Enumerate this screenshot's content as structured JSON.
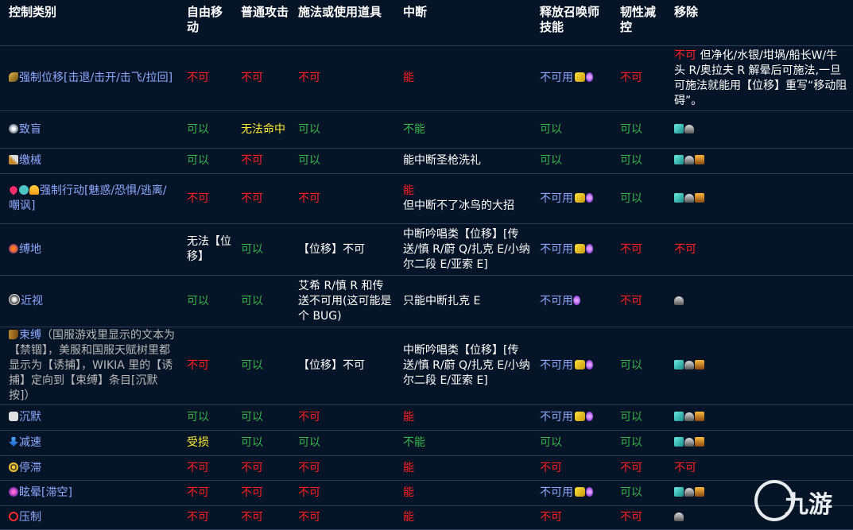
{
  "headers": [
    "控制类别",
    "自由移动",
    "普通攻击",
    "施法或使用道具",
    "中断",
    "释放召唤师技能",
    "韧性减控",
    "移除"
  ],
  "rows": [
    {
      "icons": [
        "knock-icon"
      ],
      "name": "强制位移[击退/击开/击飞/拉回]",
      "note": "",
      "move": {
        "text": "不可",
        "color": "red"
      },
      "attack": {
        "text": "不可",
        "color": "red"
      },
      "cast": {
        "text": "不可",
        "color": "red"
      },
      "interrupt": {
        "lines": [
          {
            "text": "能",
            "color": "red"
          }
        ]
      },
      "summoner": {
        "text": "不可用",
        "color": "blue",
        "icons": [
          "flash-icon",
          "purple-icon"
        ]
      },
      "tenacity": {
        "text": "不可",
        "color": "red"
      },
      "remove": {
        "prefix": "不可",
        "prefix_color": "red",
        "text": " 但净化/水银/坩埚/船长W/牛头 R/奥拉夫 R 解晕后可施法,一旦可施法就能用【位移】重写“移动阻碍”。",
        "icons": []
      }
    },
    {
      "icons": [
        "blind-icon"
      ],
      "name": "致盲",
      "note": "",
      "move": {
        "text": "可以",
        "color": "green"
      },
      "attack": {
        "text": "无法命中",
        "color": "yellow"
      },
      "cast": {
        "text": "可以",
        "color": "green"
      },
      "interrupt": {
        "lines": [
          {
            "text": "不能",
            "color": "green"
          }
        ]
      },
      "summoner": {
        "text": "可以",
        "color": "green",
        "icons": []
      },
      "tenacity": {
        "text": "可以",
        "color": "green"
      },
      "remove": {
        "prefix": "",
        "prefix_color": "",
        "text": "",
        "icons": [
          "cleanse-icon",
          "qss-icon"
        ]
      }
    },
    {
      "icons": [
        "disarm-icon"
      ],
      "name": "缴械",
      "note": "",
      "move": {
        "text": "可以",
        "color": "green"
      },
      "attack": {
        "text": "不可",
        "color": "red"
      },
      "cast": {
        "text": "可以",
        "color": "green"
      },
      "interrupt": {
        "lines": [
          {
            "text": "能中断圣枪洗礼",
            "color": "white"
          }
        ]
      },
      "summoner": {
        "text": "可以",
        "color": "green",
        "icons": []
      },
      "tenacity": {
        "text": "可以",
        "color": "green"
      },
      "remove": {
        "prefix": "",
        "prefix_color": "",
        "text": "",
        "icons": [
          "cleanse-icon",
          "qss-icon",
          "mercurial-icon"
        ]
      }
    },
    {
      "icons": [
        "charm-icon",
        "fear-icon",
        "flee-icon"
      ],
      "name": "强制行动[魅惑/恐惧/逃离/嘲讽]",
      "note": "",
      "move": {
        "text": "不可",
        "color": "red"
      },
      "attack": {
        "text": "不可",
        "color": "red"
      },
      "cast": {
        "text": "不可",
        "color": "red"
      },
      "interrupt": {
        "lines": [
          {
            "text": "能",
            "color": "red"
          },
          {
            "text": "但中断不了冰鸟的大招",
            "color": "white"
          }
        ]
      },
      "summoner": {
        "text": "不可用",
        "color": "blue",
        "icons": [
          "flash-icon",
          "purple-icon"
        ]
      },
      "tenacity": {
        "text": "可以",
        "color": "green"
      },
      "remove": {
        "prefix": "",
        "prefix_color": "",
        "text": "",
        "icons": [
          "cleanse-icon",
          "qss-icon",
          "mercurial-icon"
        ]
      }
    },
    {
      "icons": [
        "root-icon"
      ],
      "name": "缚地",
      "note": "",
      "move": {
        "text": "无法【位移】",
        "color": "white"
      },
      "attack": {
        "text": "可以",
        "color": "green"
      },
      "cast": {
        "text": "【位移】不可",
        "color": "white"
      },
      "interrupt": {
        "lines": [
          {
            "text": "中断吟唱类【位移】[传送/慎 R/蔚 Q/扎克 E/小纳尔二段 E/亚索 E]",
            "color": "white"
          }
        ]
      },
      "summoner": {
        "text": "不可用",
        "color": "blue",
        "icons": [
          "flash-icon",
          "purple-icon"
        ]
      },
      "tenacity": {
        "text": "不可",
        "color": "red"
      },
      "remove": {
        "prefix": "不可",
        "prefix_color": "red",
        "text": "",
        "icons": []
      }
    },
    {
      "icons": [
        "nearsight-icon"
      ],
      "name": "近视",
      "note": "",
      "move": {
        "text": "可以",
        "color": "green"
      },
      "attack": {
        "text": "可以",
        "color": "green"
      },
      "cast": {
        "text": "艾希 R/慎 R 和传送不可用(这可能是个 BUG)",
        "color": "white"
      },
      "interrupt": {
        "lines": [
          {
            "text": "只能中断扎克 E",
            "color": "white"
          }
        ]
      },
      "summoner": {
        "text": "不可用",
        "color": "blue",
        "icons": [
          "purple-icon"
        ]
      },
      "tenacity": {
        "text": "不可",
        "color": "red"
      },
      "remove": {
        "prefix": "",
        "prefix_color": "",
        "text": "",
        "icons": [
          "qss-icon"
        ]
      }
    },
    {
      "icons": [
        "boot-icon"
      ],
      "name": "束缚",
      "note": "（国服游戏里显示的文本为【禁锢】，美服和国服天赋树里都显示为【诱捕】，WIKIA 里的【诱捕】定向到【束缚】条目[沉默按]）",
      "move": {
        "text": "不可",
        "color": "red"
      },
      "attack": {
        "text": "可以",
        "color": "green"
      },
      "cast": {
        "text": "【位移】不可",
        "color": "white"
      },
      "interrupt": {
        "lines": [
          {
            "text": "中断吟唱类【位移】[传送/慎 R/蔚 Q/扎克 E/小纳尔二段 E/亚索 E]",
            "color": "white"
          }
        ]
      },
      "summoner": {
        "text": "不可用",
        "color": "blue",
        "icons": [
          "flash-icon",
          "purple-icon"
        ]
      },
      "tenacity": {
        "text": "可以",
        "color": "green"
      },
      "remove": {
        "prefix": "",
        "prefix_color": "",
        "text": "",
        "icons": [
          "cleanse-icon",
          "qss-icon",
          "mercurial-icon"
        ]
      }
    },
    {
      "icons": [
        "silence-icon"
      ],
      "name": "沉默",
      "note": "",
      "move": {
        "text": "可以",
        "color": "green"
      },
      "attack": {
        "text": "可以",
        "color": "green"
      },
      "cast": {
        "text": "不可",
        "color": "red"
      },
      "interrupt": {
        "lines": [
          {
            "text": "能",
            "color": "red"
          }
        ]
      },
      "summoner": {
        "text": "不可用",
        "color": "blue",
        "icons": [
          "flash-icon",
          "purple-icon"
        ]
      },
      "tenacity": {
        "text": "可以",
        "color": "green"
      },
      "remove": {
        "prefix": "",
        "prefix_color": "",
        "text": "",
        "icons": [
          "cleanse-icon",
          "qss-icon",
          "mercurial-icon"
        ]
      }
    },
    {
      "icons": [
        "slow-icon"
      ],
      "name": "减速",
      "note": "",
      "move": {
        "text": "受损",
        "color": "yellow"
      },
      "attack": {
        "text": "可以",
        "color": "green"
      },
      "cast": {
        "text": "可以",
        "color": "green"
      },
      "interrupt": {
        "lines": [
          {
            "text": "不能",
            "color": "green"
          }
        ]
      },
      "summoner": {
        "text": "可以",
        "color": "green",
        "icons": []
      },
      "tenacity": {
        "text": "可以",
        "color": "green"
      },
      "remove": {
        "prefix": "",
        "prefix_color": "",
        "text": "",
        "icons": [
          "cleanse-icon",
          "qss-icon",
          "mercurial-icon"
        ]
      }
    },
    {
      "icons": [
        "stasis-icon"
      ],
      "name": "停滞",
      "note": "",
      "move": {
        "text": "不可",
        "color": "red"
      },
      "attack": {
        "text": "不可",
        "color": "red"
      },
      "cast": {
        "text": "不可",
        "color": "red"
      },
      "interrupt": {
        "lines": [
          {
            "text": "能",
            "color": "red"
          }
        ]
      },
      "summoner": {
        "text": "不可",
        "color": "red",
        "icons": []
      },
      "tenacity": {
        "text": "不可",
        "color": "red"
      },
      "remove": {
        "prefix": "不可",
        "prefix_color": "red",
        "text": "",
        "icons": []
      }
    },
    {
      "icons": [
        "stun-icon"
      ],
      "name": "眩晕[滞空]",
      "note": "",
      "move": {
        "text": "不可",
        "color": "red"
      },
      "attack": {
        "text": "不可",
        "color": "red"
      },
      "cast": {
        "text": "不可",
        "color": "red"
      },
      "interrupt": {
        "lines": [
          {
            "text": "能",
            "color": "red"
          }
        ]
      },
      "summoner": {
        "text": "不可用",
        "color": "blue",
        "icons": [
          "flash-icon",
          "purple-icon"
        ]
      },
      "tenacity": {
        "text": "可以",
        "color": "green"
      },
      "remove": {
        "prefix": "",
        "prefix_color": "",
        "text": "",
        "icons": [
          "cleanse-icon",
          "qss-icon",
          "mercurial-icon"
        ]
      }
    },
    {
      "icons": [
        "suppress-icon"
      ],
      "name": "压制",
      "note": "",
      "move": {
        "text": "不可",
        "color": "red"
      },
      "attack": {
        "text": "不可",
        "color": "red"
      },
      "cast": {
        "text": "不可",
        "color": "red"
      },
      "interrupt": {
        "lines": [
          {
            "text": "能",
            "color": "red"
          }
        ]
      },
      "summoner": {
        "text": "不可",
        "color": "red",
        "icons": []
      },
      "tenacity": {
        "text": "不可",
        "color": "red"
      },
      "remove": {
        "prefix": "",
        "prefix_color": "",
        "text": "",
        "icons": [
          "qss-icon"
        ]
      }
    }
  ],
  "watermark": {
    "text": "九游"
  }
}
